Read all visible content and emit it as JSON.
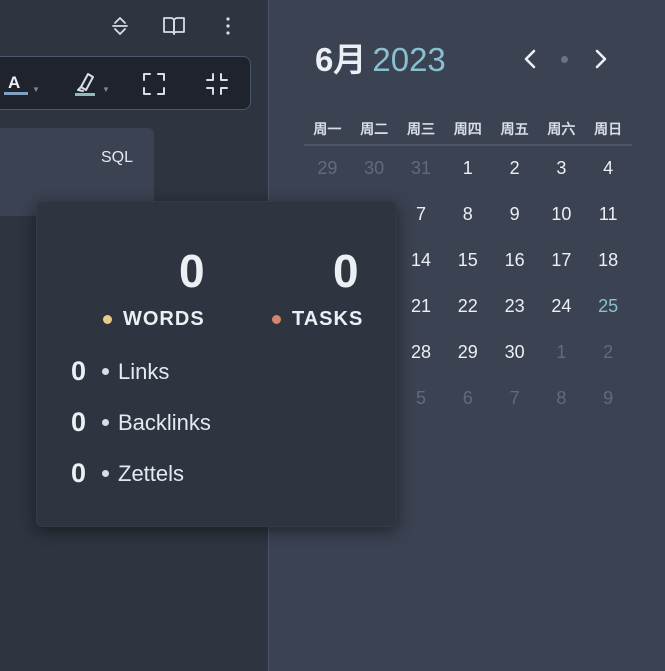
{
  "toolbar": {
    "icons": [
      "collapse-expand-icon",
      "book-open-icon",
      "more-vertical-icon"
    ],
    "format_buttons": [
      "text-color-icon",
      "highlighter-icon",
      "fullscreen-icon",
      "exit-fullscreen-icon"
    ],
    "text_color_letter": "A",
    "text_color_accent": "#81a1c1",
    "highlight_accent": "#8fbcbb"
  },
  "code_block": {
    "language": "SQL"
  },
  "stats": {
    "words": {
      "count": "0",
      "label": "WORDS",
      "color": "#ebcb8b"
    },
    "tasks": {
      "count": "0",
      "label": "TASKS",
      "color": "#d08770"
    },
    "links": [
      {
        "count": "0",
        "label": "Links"
      },
      {
        "count": "0",
        "label": "Backlinks"
      },
      {
        "count": "0",
        "label": "Zettels"
      }
    ]
  },
  "calendar": {
    "month": "6月",
    "year": "2023",
    "weekdays": [
      "周一",
      "周二",
      "周三",
      "周四",
      "周五",
      "周六",
      "周日"
    ],
    "weeks": [
      [
        {
          "d": "29",
          "s": "muted"
        },
        {
          "d": "30",
          "s": "muted"
        },
        {
          "d": "31",
          "s": "muted"
        },
        {
          "d": "1",
          "s": ""
        },
        {
          "d": "2",
          "s": ""
        },
        {
          "d": "3",
          "s": ""
        },
        {
          "d": "4",
          "s": ""
        }
      ],
      [
        {
          "d": "",
          "s": ""
        },
        {
          "d": "",
          "s": ""
        },
        {
          "d": "7",
          "s": ""
        },
        {
          "d": "8",
          "s": ""
        },
        {
          "d": "9",
          "s": ""
        },
        {
          "d": "10",
          "s": ""
        },
        {
          "d": "11",
          "s": ""
        }
      ],
      [
        {
          "d": "",
          "s": ""
        },
        {
          "d": "",
          "s": ""
        },
        {
          "d": "14",
          "s": ""
        },
        {
          "d": "15",
          "s": ""
        },
        {
          "d": "16",
          "s": ""
        },
        {
          "d": "17",
          "s": ""
        },
        {
          "d": "18",
          "s": ""
        }
      ],
      [
        {
          "d": "",
          "s": ""
        },
        {
          "d": "",
          "s": ""
        },
        {
          "d": "21",
          "s": ""
        },
        {
          "d": "22",
          "s": ""
        },
        {
          "d": "23",
          "s": ""
        },
        {
          "d": "24",
          "s": ""
        },
        {
          "d": "25",
          "s": "today"
        }
      ],
      [
        {
          "d": "",
          "s": ""
        },
        {
          "d": "",
          "s": ""
        },
        {
          "d": "28",
          "s": ""
        },
        {
          "d": "29",
          "s": ""
        },
        {
          "d": "30",
          "s": ""
        },
        {
          "d": "1",
          "s": "muted"
        },
        {
          "d": "2",
          "s": "muted"
        }
      ],
      [
        {
          "d": "",
          "s": ""
        },
        {
          "d": "",
          "s": ""
        },
        {
          "d": "5",
          "s": "muted"
        },
        {
          "d": "6",
          "s": "muted"
        },
        {
          "d": "7",
          "s": "muted"
        },
        {
          "d": "8",
          "s": "muted"
        },
        {
          "d": "9",
          "s": "muted"
        }
      ]
    ]
  }
}
